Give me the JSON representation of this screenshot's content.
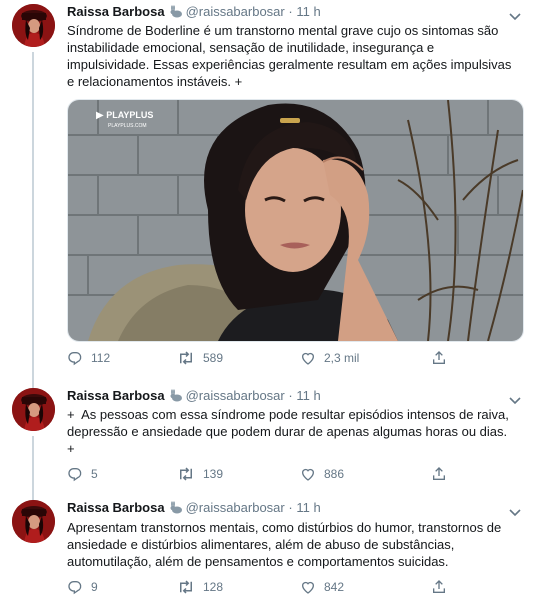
{
  "tweets": [
    {
      "name": "Raissa Barbosa",
      "handle": "@raissabarbosar",
      "time": "11 h",
      "text": "Síndrome de Boderline é um transtorno mental grave cujo os sintomas são\ninstabilidade emocional, sensação de inutilidade, insegurança e\nimpulsividade. Essas experiências geralmente resultam em ações impulsivas\ne relacionamentos instáveis. +",
      "media": {
        "watermark_brand": "PLAYPLUS",
        "watermark_url": "PLAYPLUS.COM"
      },
      "replies": "112",
      "retweets": "589",
      "likes": "2,3 mil"
    },
    {
      "name": "Raissa Barbosa",
      "handle": "@raissabarbosar",
      "time": "11 h",
      "text": "+  As pessoas com essa síndrome pode resultar episódios intensos de raiva,\ndepressão e ansiedade que podem durar de apenas algumas horas ou dias.\n+",
      "replies": "5",
      "retweets": "139",
      "likes": "886"
    },
    {
      "name": "Raissa Barbosa",
      "handle": "@raissabarbosar",
      "time": "11 h",
      "text": "Apresentam transtornos mentais, como distúrbios do humor, transtornos de\nansiedade e distúrbios alimentares, além de abuso de substâncias,\nautomutilação, além de pensamentos e comportamentos suicidas.",
      "replies": "9",
      "retweets": "128",
      "likes": "842"
    }
  ],
  "separator": "·",
  "icons": {
    "reply": "reply-icon",
    "retweet": "retweet-icon",
    "like": "heart-icon",
    "share": "share-icon",
    "caret": "chevron-down-icon",
    "badge": "rabbit-icon"
  },
  "colors": {
    "text": "#14171a",
    "muted": "#657786",
    "thread": "#ccd6dd"
  }
}
